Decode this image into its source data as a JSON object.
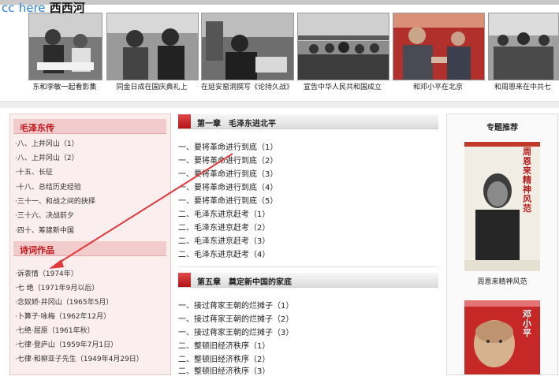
{
  "watermark": {
    "cc": "cc",
    "here": "here",
    "site": "西西河"
  },
  "gallery": {
    "captions": [
      "东和李敏一起看影集",
      "同金日成在国庆典礼上",
      "在延安窑洞撰写《论持久战》",
      "宣告中华人民共和国成立",
      "和邓小平在北京",
      "和周恩来在中共七"
    ]
  },
  "left": {
    "section1": {
      "title": "毛泽东传",
      "items": [
        "·八、上井冈山（1）",
        "·八、上井冈山（2）",
        "·十五、长征",
        "·十八、总结历史经验",
        "·三十一、和战之间的抉择",
        "·三十六、决战前夕",
        "·四十、筹建新中国"
      ]
    },
    "section2": {
      "title": "诗词作品",
      "items": [
        "·诉衷情（1974年）",
        "·七 绝（1971年9月以后）",
        "·念奴娇·井冈山（1965年5月）",
        "·卜算子·咏梅（1962年12月）",
        "·七绝·屈原（1961年秋）",
        "·七律·登庐山（1959年7月1日）",
        "·七律·和柳亚子先生（1949年4月29日）"
      ]
    }
  },
  "main": {
    "chapter1": {
      "title": "第一章　毛泽东进北平",
      "items": [
        "一、要将革命进行到底（1）",
        "一、要将革命进行到底（2）",
        "一、要将革命进行到底（3）",
        "一、要将革命进行到底（4）",
        "一、要将革命进行到底（5）",
        "二、毛泽东进京赶考（1）",
        "二、毛泽东进京赶考（2）",
        "二、毛泽东进京赶考（3）",
        "二、毛泽东进京赶考（4）"
      ]
    },
    "chapter5": {
      "title": "第五章　奠定新中国的家底",
      "items": [
        "一、接过蒋家王朝的烂摊子（1）",
        "一、接过蒋家王朝的烂摊子（2）",
        "一、接过蒋家王朝的烂摊子（3）",
        "二、整顿旧经济秩序（1）",
        "二、整顿旧经济秩序（2）",
        "二、整顿旧经济秩序（3）"
      ]
    }
  },
  "right": {
    "title": "专题推荐",
    "book1": {
      "caption": "周恩来精神风范",
      "cover_text": "周恩来 精神风范"
    },
    "book2": {
      "cover_text": "邓小平"
    }
  },
  "colors": {
    "accent_red": "#c0171b",
    "annotation_arrow": "#e23a3a"
  }
}
